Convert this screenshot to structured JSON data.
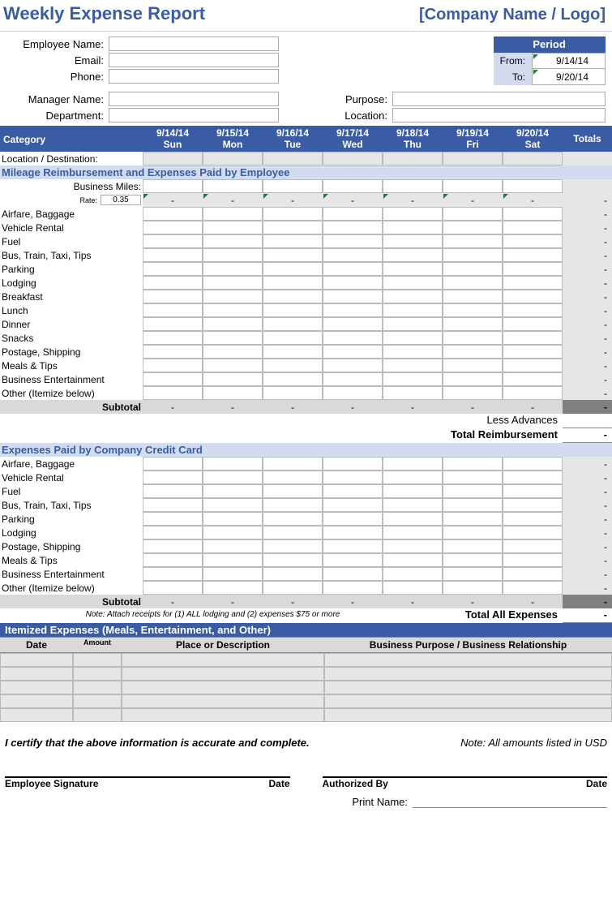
{
  "title": "Weekly Expense Report",
  "company": "[Company Name / Logo]",
  "employee": {
    "name_label": "Employee Name:",
    "email_label": "Email:",
    "phone_label": "Phone:",
    "manager_label": "Manager Name:",
    "department_label": "Department:"
  },
  "period": {
    "header": "Period",
    "from_label": "From:",
    "to_label": "To:",
    "from": "9/14/14",
    "to": "9/20/14"
  },
  "right_fields": {
    "purpose_label": "Purpose:",
    "location_label": "Location:"
  },
  "grid": {
    "category_label": "Category",
    "totals_label": "Totals",
    "days": [
      {
        "date": "9/14/14",
        "name": "Sun"
      },
      {
        "date": "9/15/14",
        "name": "Mon"
      },
      {
        "date": "9/16/14",
        "name": "Tue"
      },
      {
        "date": "9/17/14",
        "name": "Wed"
      },
      {
        "date": "9/18/14",
        "name": "Thu"
      },
      {
        "date": "9/19/14",
        "name": "Fri"
      },
      {
        "date": "9/20/14",
        "name": "Sat"
      }
    ],
    "location_dest_label": "Location / Destination:"
  },
  "section1": {
    "header": "Mileage Reimbursement and Expenses Paid by Employee",
    "business_miles_label": "Business Miles:",
    "rate_label": "Rate:",
    "rate_value": "0.35",
    "rows": [
      "Airfare, Baggage",
      "Vehicle Rental",
      "Fuel",
      "Bus, Train, Taxi, Tips",
      "Parking",
      "Lodging",
      "Breakfast",
      "Lunch",
      "Dinner",
      "Snacks",
      "Postage, Shipping",
      "Meals & Tips",
      "Business Entertainment",
      "Other (Itemize below)"
    ],
    "subtotal_label": "Subtotal",
    "less_advances_label": "Less Advances",
    "total_reimbursement_label": "Total Reimbursement"
  },
  "section2": {
    "header": "Expenses Paid by Company Credit Card",
    "rows": [
      "Airfare, Baggage",
      "Vehicle Rental",
      "Fuel",
      "Bus, Train, Taxi, Tips",
      "Parking",
      "Lodging",
      "Postage, Shipping",
      "Meals & Tips",
      "Business Entertainment",
      "Other (Itemize below)"
    ],
    "subtotal_label": "Subtotal",
    "note": "Note:   Attach receipts for (1) ALL lodging and (2) expenses $75 or more",
    "total_all_label": "Total All Expenses"
  },
  "itemized": {
    "header": "Itemized Expenses (Meals, Entertainment, and Other)",
    "date_label": "Date",
    "amount_label": "Amount",
    "place_label": "Place or Description",
    "purpose_label": "Business Purpose / Business Relationship",
    "row_count": 5
  },
  "footer": {
    "certify": "I certify that the above information is accurate and complete.",
    "note_usd": "Note: All amounts listed in USD",
    "emp_sig": "Employee Signature",
    "date_label": "Date",
    "auth_by": "Authorized By",
    "print_name_label": "Print Name:"
  },
  "dash": "-"
}
